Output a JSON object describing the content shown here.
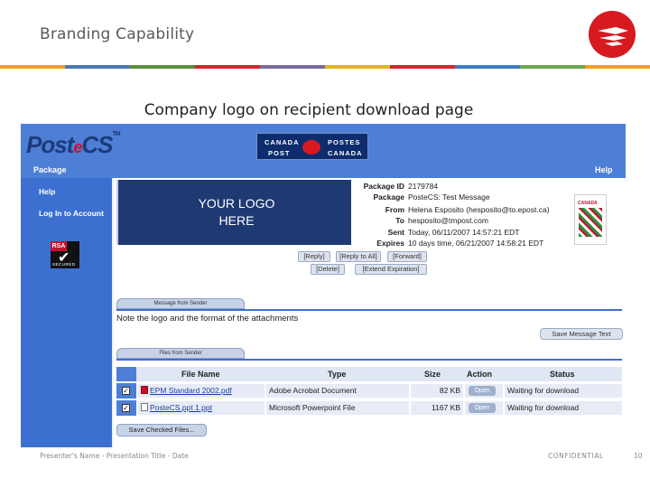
{
  "slide": {
    "title": "Branding Capability",
    "caption": "Company logo on recipient download page",
    "stripe_colors": [
      "#f0a21c",
      "#4c79b4",
      "#5b8e3d",
      "#d4262c",
      "#7b6a9c",
      "#e6b51e",
      "#d4262c",
      "#3f7fc1",
      "#6aa84f",
      "#f0a21c"
    ],
    "brand_color": "#d71920"
  },
  "app": {
    "logo_text": "Post",
    "logo_e": "e",
    "logo_cs": "CS",
    "logo_tm": "TM",
    "cp_logo": {
      "top_left": "CANADA",
      "top_right": "POSTES",
      "bottom_left": "POST",
      "bottom_right": "CANADA"
    },
    "nav": {
      "left": "Package",
      "right": "Help"
    },
    "sidebar": {
      "items": [
        "Help",
        "Log In to Account"
      ],
      "badge": {
        "brand": "RSA",
        "label": "SECURED"
      }
    },
    "logo_placeholder": {
      "line1": "YOUR LOGO",
      "line2": "HERE"
    },
    "package": {
      "id_label": "Package ID",
      "id_value": "2179784",
      "package_label": "Package",
      "package_value": "PosteCS: Test Message",
      "from_label": "From",
      "from_value": "Helena Esposito (hesposito@to.epost.ca)",
      "to_label": "To",
      "to_value": "hesposito@tmpost.com",
      "sent_label": "Sent",
      "sent_value": "Today, 06/11/2007 14:57:21 EDT",
      "expires_label": "Expires",
      "expires_value": "10 days time, 06/21/2007 14:58:21 EDT"
    },
    "badge_right": "CANADA",
    "actions": [
      "[Reply]",
      "[Reply to All]",
      "[Forward]",
      "[Delete]",
      "[Extend Expiration]"
    ],
    "message_tab": "Message from Sender",
    "note": "Note the logo and the format of the attachments",
    "save_message": "Save Message Text",
    "files_tab": "Files from Sender",
    "table": {
      "headers": [
        "File Name",
        "Type",
        "Size",
        "Action",
        "Status"
      ],
      "rows": [
        {
          "name": "EPM Standard 2002.pdf",
          "icon": "pdf-icon",
          "type": "Adobe Acrobat Document",
          "size": "82 KB",
          "action": "Open",
          "status": "Waiting for download"
        },
        {
          "name": "PosteCS.ppt 1.ppt",
          "icon": "document-icon",
          "type": "Microsoft Powerpoint File",
          "size": "1167 KB",
          "action": "Open",
          "status": "Waiting for download"
        }
      ]
    },
    "save_checked": "Save Checked Files..."
  },
  "footer": {
    "left": "Presenter's Name - Presentation Title - Date",
    "confidential": "CONFIDENTIAL",
    "page": "10"
  }
}
